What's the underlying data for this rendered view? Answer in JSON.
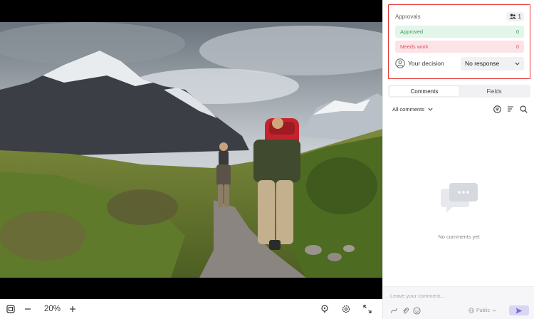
{
  "viewer": {
    "zoom": "20%",
    "image_alt": "Hikers on a mountain trail"
  },
  "approvals": {
    "title": "Approvals",
    "reviewer_count": "1",
    "approved_label": "Approved",
    "approved_count": "0",
    "needs_work_label": "Needs work",
    "needs_work_count": "0",
    "decision_label": "Your decision",
    "decision_value": "No response"
  },
  "tabs": [
    {
      "label": "Comments",
      "active": true
    },
    {
      "label": "Fields",
      "active": false
    }
  ],
  "filter": {
    "label": "All comments"
  },
  "empty_state": {
    "text": "No comments yet"
  },
  "composer": {
    "placeholder": "Leave your comment...",
    "visibility": "Public"
  },
  "colors": {
    "accent": "#7b6fd6",
    "approved_bg": "#e4f5ea",
    "approved_text": "#3d9b5c",
    "needs_bg": "#fbe3e6",
    "needs_text": "#e0545f",
    "highlight_border": "#e53935"
  }
}
